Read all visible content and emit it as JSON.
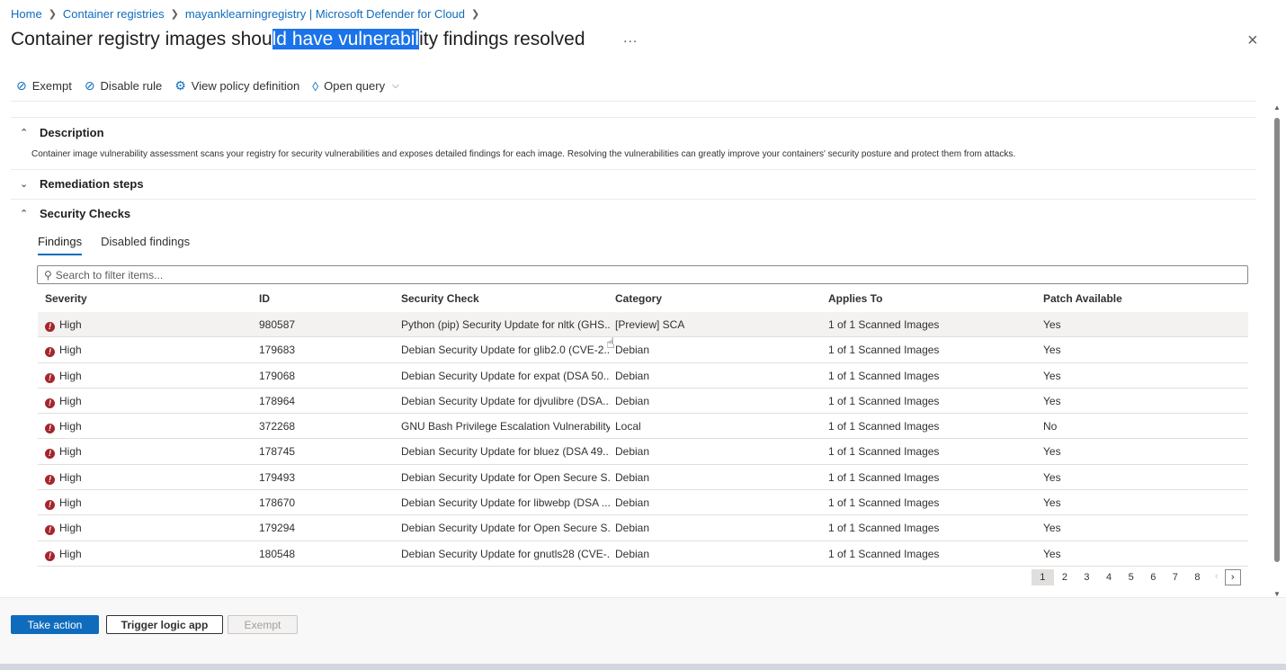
{
  "breadcrumb": [
    "Home",
    "Container registries",
    "mayanklearningregistry | Microsoft Defender for Cloud"
  ],
  "title": {
    "before": "Container registry images shou",
    "highlighted": "ld have vulnerabil",
    "after": "ity findings resolved"
  },
  "header_more": "...",
  "close_icon": "×",
  "toolbar": {
    "exempt": "Exempt",
    "disable_rule": "Disable rule",
    "view_policy": "View policy definition",
    "open_query": "Open query"
  },
  "sections": {
    "description": {
      "title": "Description",
      "text": "Container image vulnerability assessment scans your registry for security vulnerabilities and exposes detailed findings for each image. Resolving the vulnerabilities can greatly improve your containers' security posture and protect them from attacks."
    },
    "remediation": {
      "title": "Remediation steps"
    },
    "security_checks": {
      "title": "Security Checks"
    }
  },
  "tabs": [
    "Findings",
    "Disabled findings"
  ],
  "search": {
    "placeholder": "Search to filter items..."
  },
  "table": {
    "columns": [
      "Severity",
      "ID",
      "Security Check",
      "Category",
      "Applies To",
      "Patch Available"
    ],
    "rows": [
      [
        "High",
        "980587",
        "Python (pip) Security Update for nltk (GHS...",
        "[Preview] SCA",
        "1 of 1 Scanned Images",
        "Yes"
      ],
      [
        "High",
        "179683",
        "Debian Security Update for glib2.0 (CVE-2...",
        "Debian",
        "1 of 1 Scanned Images",
        "Yes"
      ],
      [
        "High",
        "179068",
        "Debian Security Update for expat (DSA 50...",
        "Debian",
        "1 of 1 Scanned Images",
        "Yes"
      ],
      [
        "High",
        "178964",
        "Debian Security Update for djvulibre (DSA...",
        "Debian",
        "1 of 1 Scanned Images",
        "Yes"
      ],
      [
        "High",
        "372268",
        "GNU Bash Privilege Escalation Vulnerability...",
        "Local",
        "1 of 1 Scanned Images",
        "No"
      ],
      [
        "High",
        "178745",
        "Debian Security Update for bluez (DSA 49...",
        "Debian",
        "1 of 1 Scanned Images",
        "Yes"
      ],
      [
        "High",
        "179493",
        "Debian Security Update for Open Secure S...",
        "Debian",
        "1 of 1 Scanned Images",
        "Yes"
      ],
      [
        "High",
        "178670",
        "Debian Security Update for libwebp (DSA ...",
        "Debian",
        "1 of 1 Scanned Images",
        "Yes"
      ],
      [
        "High",
        "179294",
        "Debian Security Update for Open Secure S...",
        "Debian",
        "1 of 1 Scanned Images",
        "Yes"
      ],
      [
        "High",
        "180548",
        "Debian Security Update for gnutls28 (CVE-...",
        "Debian",
        "1 of 1 Scanned Images",
        "Yes"
      ]
    ]
  },
  "pagination": {
    "pages": [
      "1",
      "2",
      "3",
      "4",
      "5",
      "6",
      "7",
      "8"
    ],
    "current": "1",
    "prev": "‹",
    "next": "›"
  },
  "footer": {
    "take_action": "Take action",
    "trigger_logic_app": "Trigger logic app",
    "exempt": "Exempt"
  },
  "colors": {
    "accent": "#0f6cbd",
    "severity_high": "#a4262c",
    "selection": "#1a73e8"
  }
}
